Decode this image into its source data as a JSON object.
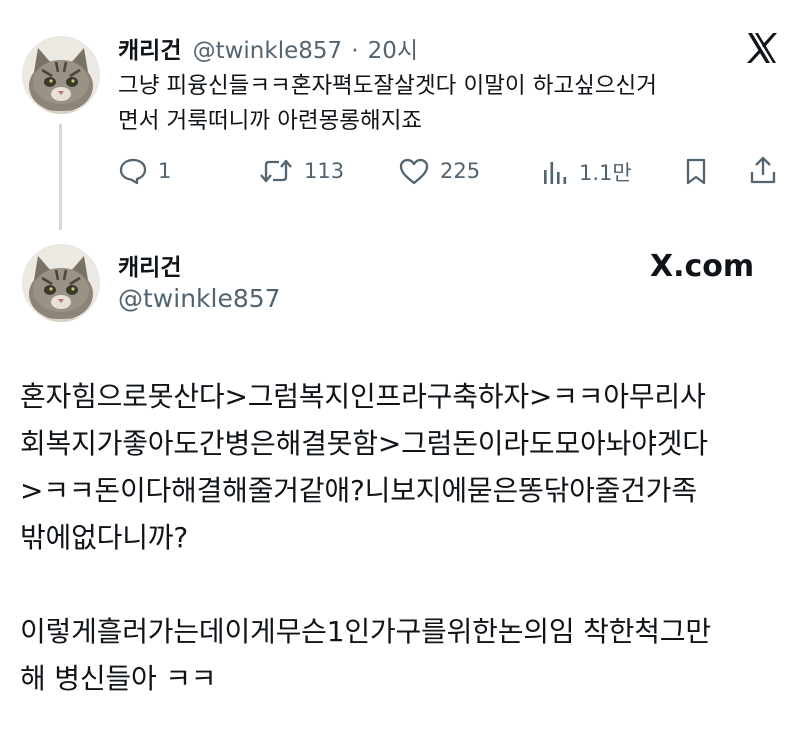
{
  "top_tweet": {
    "display_name": "캐리건",
    "handle": "@twinkle857",
    "separator": "·",
    "time": "20시",
    "text_line1": "그냥 피융신들ㅋㅋ혼자펵도잘살겟다 이말이 하고싶으신거",
    "text_line2": "면서 거룩떠니까 아련몽롱해지죠",
    "stats": {
      "replies": "1",
      "retweets": "113",
      "likes": "225",
      "views": "1.1만"
    }
  },
  "main_tweet": {
    "display_name": "캐리건",
    "handle": "@twinkle857",
    "brand": "X.com",
    "paragraph1_lines": [
      "혼자힘으로못산다>그럼복지인프라구축하자>ㅋㅋ아무리사",
      "회복지가좋아도간병은해결못함>그럼돈이라도모아놔야겟다",
      ">ㅋㅋ돈이다해결해줄거같애?니보지에묻은똥닦아줄건가족",
      "밖에없다니까?"
    ],
    "paragraph2_lines": [
      "이렇게흘러가는데이게무슨1인가구를위한논의임 착한척그만",
      "해 병신들아 ㅋㅋ"
    ]
  },
  "icons": {
    "x_logo": "x-logo-icon",
    "reply": "reply-icon",
    "retweet": "retweet-icon",
    "like": "heart-icon",
    "views": "views-icon",
    "bookmark": "bookmark-icon",
    "share": "share-icon",
    "avatar": "cat-avatar"
  },
  "colors": {
    "text": "#0f1419",
    "muted": "#536471",
    "thread_line": "#cfd9de"
  }
}
